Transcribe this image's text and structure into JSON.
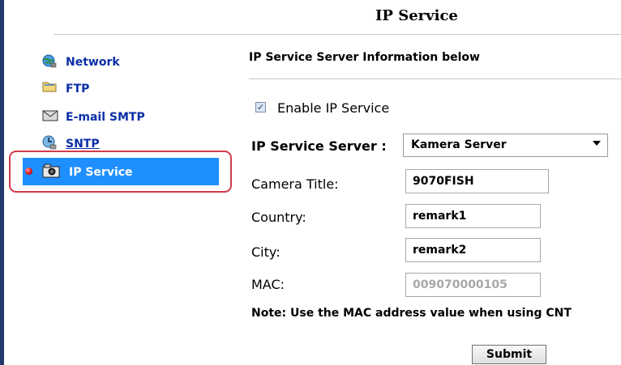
{
  "page": {
    "title": "IP Service"
  },
  "sidebar": {
    "items": [
      {
        "label": "Network",
        "icon": "globe-network-icon"
      },
      {
        "label": "FTP",
        "icon": "folder-icon"
      },
      {
        "label": "E-mail SMTP",
        "icon": "envelope-icon"
      },
      {
        "label": "SNTP",
        "icon": "clock-globe-icon"
      },
      {
        "label": "IP Service",
        "icon": "camera-icon",
        "active": true
      }
    ],
    "active_color": "#1f8fff",
    "link_color": "#0b2ea8",
    "highlight_outline_color": "#d13b4a"
  },
  "content": {
    "section_heading": "IP Service Server Information below",
    "enable_label": "Enable IP Service",
    "enable_checked": true,
    "server": {
      "label": "IP Service Server :",
      "selected": "Kamera Server"
    },
    "fields": {
      "camera_title": {
        "label": "Camera Title:",
        "value": "9070FISH"
      },
      "country": {
        "label": "Country:",
        "value": "remark1"
      },
      "city": {
        "label": "City:",
        "value": "remark2"
      },
      "mac": {
        "label": "MAC:",
        "value": "009070000105",
        "disabled": true
      }
    },
    "note": "Note: Use the MAC address value when using CNT",
    "submit_label": "Submit"
  }
}
